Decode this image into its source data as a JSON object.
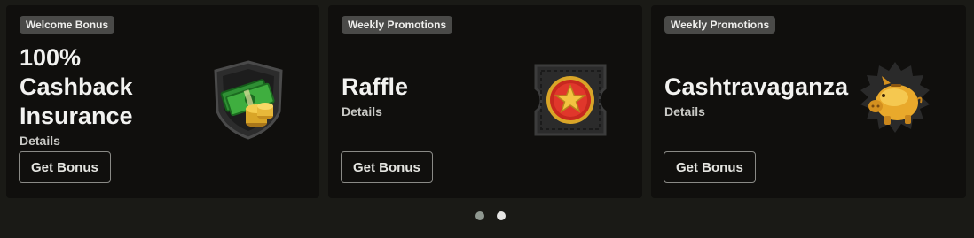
{
  "cards": [
    {
      "badge": "Welcome Bonus",
      "title": "100% Cashback Insurance",
      "details": "Details",
      "button": "Get Bonus",
      "icon": "cash-shield-icon"
    },
    {
      "badge": "Weekly Promotions",
      "title": "Raffle",
      "details": "Details",
      "button": "Get Bonus",
      "icon": "raffle-ticket-star-icon"
    },
    {
      "badge": "Weekly Promotions",
      "title": "Cashtravaganza",
      "details": "Details",
      "button": "Get Bonus",
      "icon": "piggy-bank-icon"
    }
  ],
  "pagination": {
    "total": 2,
    "active_index": 2
  },
  "colors": {
    "page_bg": "#1a1a16",
    "card_bg": "#100f0d",
    "badge_bg": "#4a4a48",
    "button_border": "#8a8a86"
  }
}
